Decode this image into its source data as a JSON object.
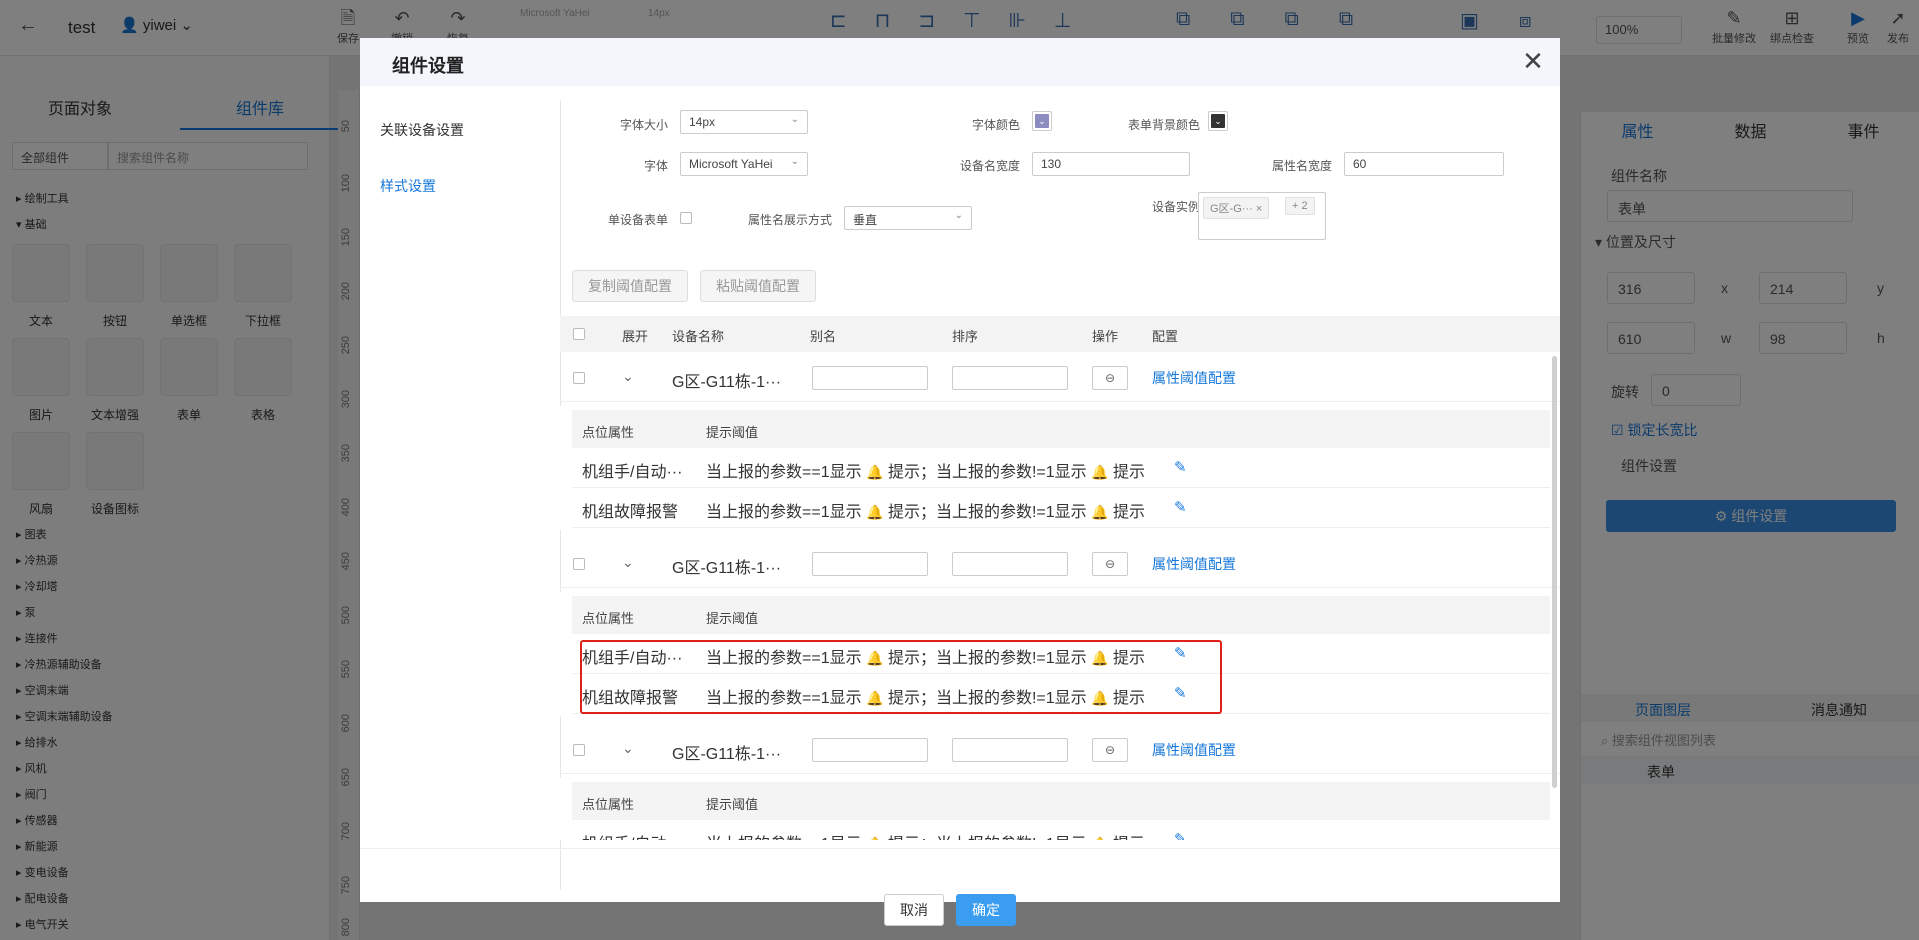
{
  "app": {
    "title": "test",
    "user": "yiwei",
    "toolbar": [
      {
        "label": "保存",
        "icon": "save-icon"
      },
      {
        "label": "撤销",
        "icon": "undo-icon"
      },
      {
        "label": "恢复",
        "icon": "redo-icon"
      },
      {
        "label": "批量修改",
        "icon": "batch-edit-icon"
      },
      {
        "label": "绑点检查",
        "icon": "bind-check-icon"
      },
      {
        "label": "预览",
        "icon": "preview-icon"
      },
      {
        "label": "发布",
        "icon": "publish-icon"
      }
    ],
    "font_placeholder": "Microsoft YaHei",
    "size_placeholder": "14px",
    "zoom": "100%"
  },
  "left_panel": {
    "tabs": [
      "页面对象",
      "组件库"
    ],
    "filter": "全部组件",
    "search_placeholder": "搜索组件名称",
    "tree_top": [
      "绘制工具",
      "基础"
    ],
    "components": [
      "文本",
      "按钮",
      "单选框",
      "下拉框",
      "图片",
      "文本增强",
      "表单",
      "表格",
      "风扇",
      "设备图标"
    ],
    "tree_rest": [
      "图表",
      "冷热源",
      "冷却塔",
      "泵",
      "连接件",
      "冷热源辅助设备",
      "空调末端",
      "空调末端辅助设备",
      "给排水",
      "风机",
      "阀门",
      "传感器",
      "新能源",
      "变电设备",
      "配电设备",
      "电气开关"
    ],
    "ruler": [
      "50",
      "100",
      "150",
      "200",
      "250",
      "300",
      "350",
      "400",
      "450",
      "500",
      "550",
      "600",
      "650",
      "700",
      "750",
      "800"
    ]
  },
  "right_panel": {
    "tabs": [
      "属性",
      "数据",
      "事件"
    ],
    "comp_name_label": "组件名称",
    "comp_name": "表单",
    "pos_label": "位置及尺寸",
    "x": "316",
    "y": "214",
    "w": "610",
    "h": "98",
    "x_label": "x",
    "y_label": "y",
    "w_label": "w",
    "h_label": "h",
    "rotate_label": "旋转",
    "rotate": "0",
    "lock_ratio": "锁定长宽比",
    "comp_setting_label": "组件设置",
    "comp_setting_btn": "组件设置",
    "layer_tabs": [
      "页面图层",
      "消息通知"
    ],
    "layer_search": "搜索组件视图列表",
    "layer_item": "表单"
  },
  "dialog": {
    "title": "组件设置",
    "side": [
      "关联设备设置",
      "样式设置"
    ],
    "form": {
      "font_size_label": "字体大小",
      "font_size": "14px",
      "font_color_label": "字体颜色",
      "bg_color_label": "表单背景颜色",
      "font_label": "字体",
      "font": "Microsoft YaHei",
      "dev_width_label": "设备名宽度",
      "dev_width": "130",
      "attr_width_label": "属性名宽度",
      "attr_width": "60",
      "single_label": "单设备表单",
      "attr_mode_label": "属性名展示方式",
      "attr_mode": "垂直",
      "instance_label": "设备实例",
      "instance_tag": "G区-G···",
      "instance_more": "+ 2"
    },
    "buttons": {
      "copy": "复制阈值配置",
      "paste": "粘贴阈值配置",
      "cancel": "取消",
      "ok": "确定"
    },
    "table_headers": [
      "展开",
      "设备名称",
      "别名",
      "排序",
      "操作",
      "配置"
    ],
    "device_name": "G区-G11栋-1···",
    "config_link": "属性阈值配置",
    "sub_headers": [
      "点位属性",
      "提示阈值"
    ],
    "attr1": "机组手/自动···",
    "attr2": "机组故障报警",
    "tip_a": "当上报的参数==1显示",
    "tip_b": "提示；当上报的参数!=1显示",
    "tip_c": "提示"
  }
}
